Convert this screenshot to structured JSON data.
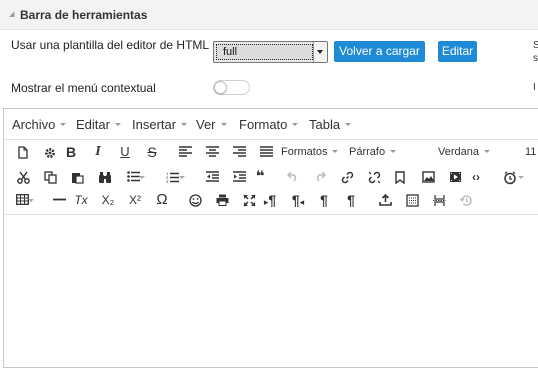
{
  "section": {
    "title": "Barra de herramientas"
  },
  "template_row": {
    "label": "Usar una plantilla del editor de HTML",
    "select_value": "full",
    "reload_button": "Volver a cargar",
    "edit_button": "Editar",
    "edge_text_1": "S",
    "edge_text_2": "s"
  },
  "context_row": {
    "label": "Mostrar el menú contextual",
    "toggle_on": false,
    "edge_text": "I"
  },
  "menubar": {
    "items": [
      "Archivo",
      "Editar",
      "Insertar",
      "Ver",
      "Formato",
      "Tabla"
    ]
  },
  "toolbar": {
    "formats_label": "Formatos",
    "block_label": "Párrafo",
    "font_label": "Verdana",
    "size_label": "11",
    "row1_icons": [
      "new-document-icon",
      "settings-gear-icon",
      "bold-icon",
      "italic-icon",
      "underline-icon",
      "strikethrough-icon",
      "align-left-icon",
      "align-center-icon",
      "align-right-icon",
      "align-justify-icon"
    ],
    "row2_icons": [
      "cut-icon",
      "copy-icon",
      "paste-icon",
      "find-binoculars-icon",
      "bullet-list-icon",
      "numbered-list-icon",
      "outdent-icon",
      "indent-icon",
      "blockquote-icon",
      "undo-icon",
      "redo-icon",
      "link-icon",
      "unlink-icon",
      "bookmark-icon",
      "image-icon",
      "media-icon",
      "code-icon",
      "clock-icon",
      "more-icon"
    ],
    "row3_icons": [
      "table-icon",
      "horizontal-rule-icon",
      "clear-formatting-icon",
      "subscript-icon",
      "superscript-icon",
      "special-char-omega-icon",
      "emoticon-icon",
      "print-icon",
      "fullscreen-icon",
      "ltr-paragraph-icon",
      "rtl-paragraph-icon",
      "paragraph-icon",
      "paragraph-alt-icon",
      "upload-icon",
      "preview-icon",
      "page-break-icon",
      "restore-icon"
    ],
    "text_glyphs": {
      "bold": "B",
      "italic": "I",
      "underline": "U",
      "strike": "S",
      "omega": "Ω",
      "pilcrow": "¶",
      "quote": "❝",
      "code": "‹›",
      "sub": "X₂",
      "sup": "X²",
      "clear": "Tx"
    }
  }
}
